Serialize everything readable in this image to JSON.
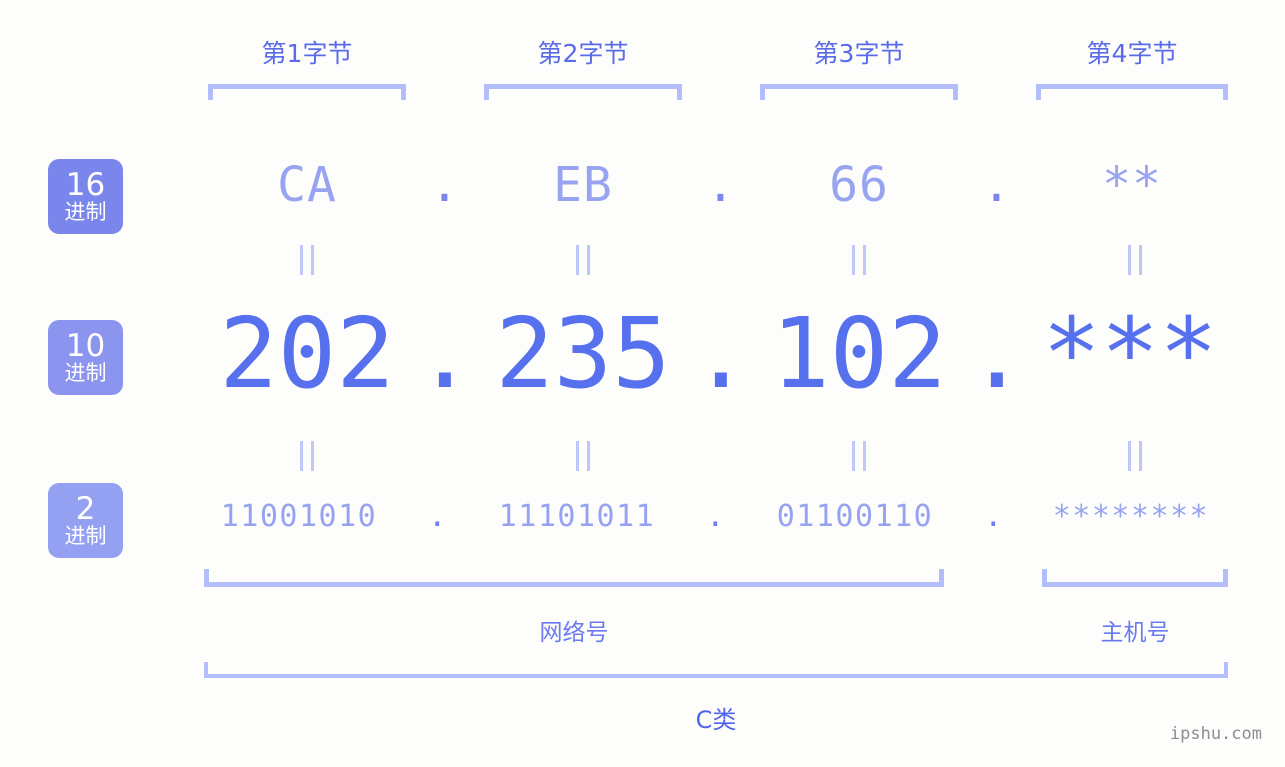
{
  "background_color": "#fdfefb",
  "accent_colors": {
    "badge_16": "#7b86ec",
    "badge_10": "#8b95ef",
    "badge_2": "#94a1f3",
    "bracket": "#b3bdf9",
    "hex_text": "#98a4f2",
    "decimal_text": "#5670ee",
    "binary_text": "#97a3f2",
    "label_text": "#5a6ae8",
    "watermark_text": "#8d8d93"
  },
  "byte_headers": [
    {
      "label": "第1字节"
    },
    {
      "label": "第2字节"
    },
    {
      "label": "第3字节"
    },
    {
      "label": "第4字节"
    }
  ],
  "radix_badges": [
    {
      "num": "16",
      "sub": "进制"
    },
    {
      "num": "10",
      "sub": "进制"
    },
    {
      "num": "2",
      "sub": "进制"
    }
  ],
  "rows": {
    "hex": {
      "values": [
        "CA",
        "EB",
        "66",
        "**"
      ],
      "separator": "."
    },
    "decimal": {
      "values": [
        "202",
        "235",
        "102",
        "***"
      ],
      "separator": "."
    },
    "binary": {
      "values": [
        "11001010",
        "11101011",
        "01100110",
        "********"
      ],
      "separator": "."
    }
  },
  "equality_mark": "=",
  "sections": [
    {
      "label": "网络号"
    },
    {
      "label": "主机号"
    }
  ],
  "address_class": {
    "label": "C类"
  },
  "watermark": {
    "text": "ipshu.com"
  }
}
